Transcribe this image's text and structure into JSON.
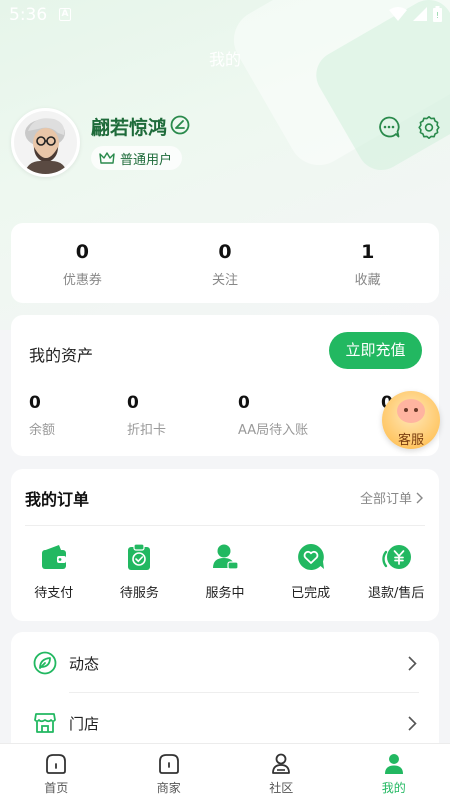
{
  "status_bar": {
    "time": "5:36",
    "notification_badge": "A"
  },
  "page_title": "我的",
  "profile": {
    "username": "翩若惊鸿",
    "level": "普通用户"
  },
  "stats": [
    {
      "value": "0",
      "label": "优惠券"
    },
    {
      "value": "0",
      "label": "关注"
    },
    {
      "value": "1",
      "label": "收藏"
    }
  ],
  "assets": {
    "title": "我的资产",
    "recharge_label": "立即充值",
    "items": [
      {
        "value": "0",
        "label": "余额"
      },
      {
        "value": "0",
        "label": "折扣卡"
      },
      {
        "value": "0",
        "label": "AA局待入账"
      },
      {
        "value": "0",
        "label": ""
      }
    ]
  },
  "customer_service": "客服",
  "orders": {
    "title": "我的订单",
    "all_label": "全部订单",
    "items": [
      {
        "label": "待支付",
        "icon": "wallet-icon"
      },
      {
        "label": "待服务",
        "icon": "clipboard-check-icon"
      },
      {
        "label": "服务中",
        "icon": "user-service-icon"
      },
      {
        "label": "已完成",
        "icon": "heart-chat-icon"
      },
      {
        "label": "退款/售后",
        "icon": "refund-yen-icon"
      }
    ]
  },
  "menu": [
    {
      "label": "动态",
      "icon": "leaf-icon"
    },
    {
      "label": "门店",
      "icon": "store-icon"
    }
  ],
  "tabs": [
    {
      "label": "首页",
      "icon": "home-icon",
      "active": false
    },
    {
      "label": "商家",
      "icon": "merchant-icon",
      "active": false
    },
    {
      "label": "社区",
      "icon": "community-icon",
      "active": false
    },
    {
      "label": "我的",
      "icon": "profile-icon",
      "active": true
    }
  ],
  "colors": {
    "accent": "#22b861",
    "username": "#1e6b3a",
    "background": "#f4f5f7"
  }
}
